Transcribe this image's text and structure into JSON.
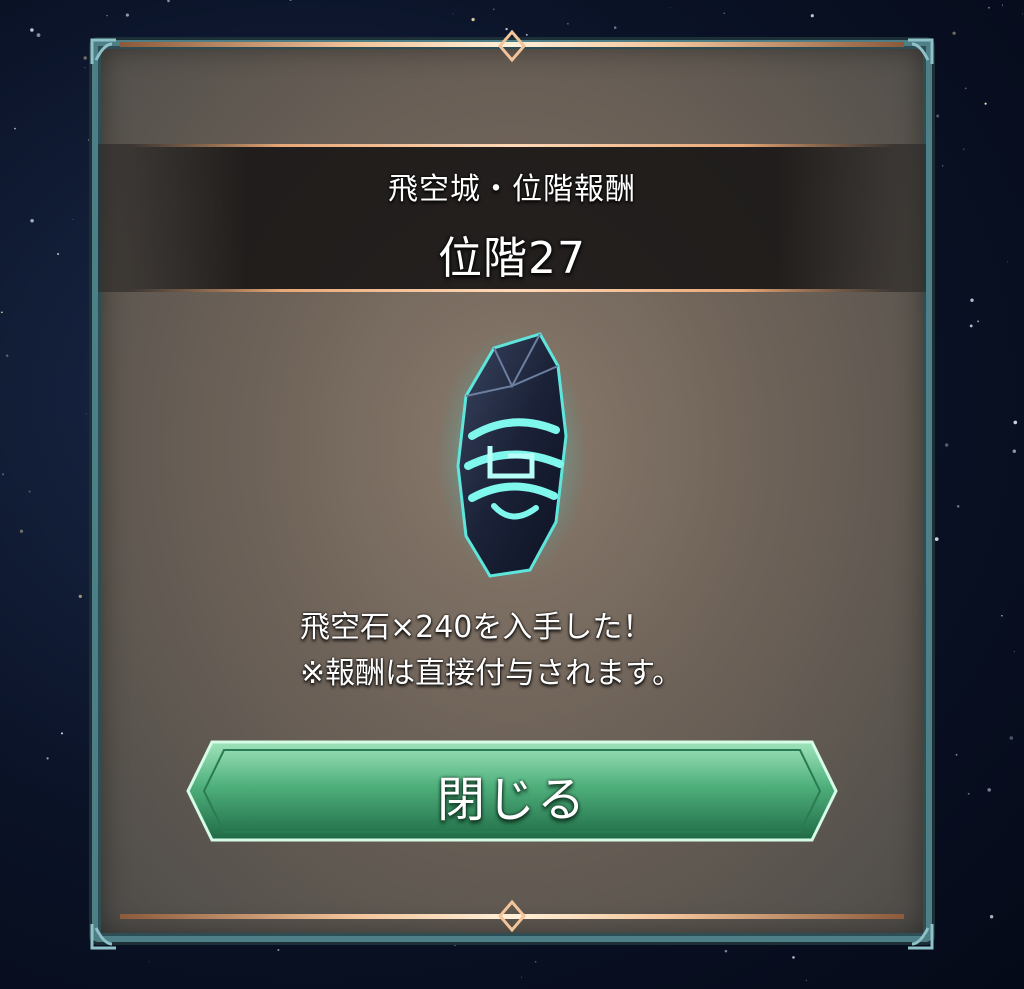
{
  "dialog": {
    "subtitle": "飛空城・位階報酬",
    "title": "位階27",
    "reward_icon": "sky-stone-crystal-icon",
    "message_line1": "飛空石×240を入手した！",
    "message_line2": "※報酬は直接付与されます。",
    "close_label": "閉じる"
  },
  "colors": {
    "frame": "#4f7f86",
    "accent_gold": "#f3c49a",
    "button_green": "#3f9a6a",
    "crystal_glow": "#6ff0e6"
  }
}
